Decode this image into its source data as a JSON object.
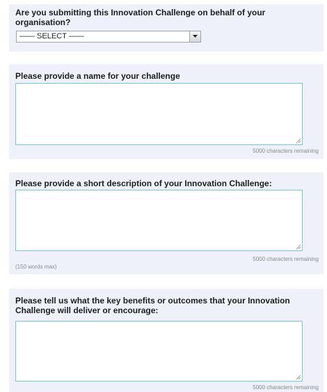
{
  "q1": {
    "label": "Are you submitting this Innovation Challenge on behalf of your organisation?",
    "select_value": "—— SELECT ——",
    "arrow_icon": "dropdown-arrow-icon"
  },
  "q2": {
    "label": "Please provide a name for your challenge",
    "counter": "5000 characters remaining"
  },
  "q3": {
    "label": "Please provide a short description of your Innovation Challenge:",
    "counter": "5000 characters remaining",
    "hint": "(150 words max)"
  },
  "q4": {
    "label": "Please tell us what the key benefits or outcomes that your Innovation Challenge will deliver or encourage:",
    "counter": "5000 characters remaining"
  },
  "colors": {
    "panel_bg": "#eef1f9",
    "textarea_border": "#6fc7e4",
    "muted_text": "#8a8a8a"
  }
}
